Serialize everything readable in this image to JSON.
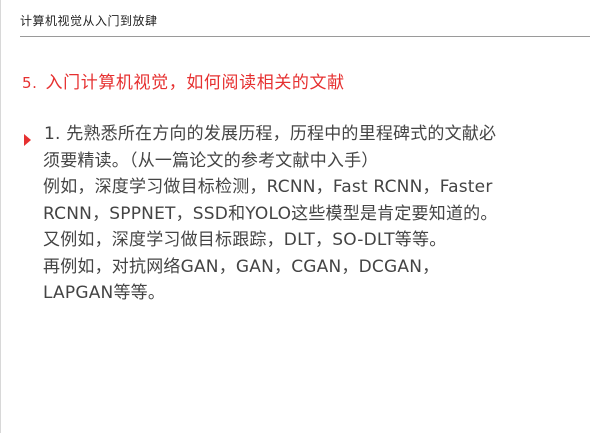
{
  "header": {
    "title": "计算机视觉从入门到放肆"
  },
  "section": {
    "number": "5.",
    "title": "入门计算机视觉，如何阅读相关的文献"
  },
  "body": {
    "lines": [
      "1. 先熟悉所在方向的发展历程，历程中的里程碑式的文献必",
      "须要精读。（从一篇论文的参考文献中入手）",
      "例如，深度学习做目标检测，RCNN，Fast RCNN，Faster",
      "RCNN，SPPNET，SSD和YOLO这些模型是肯定要知道的。",
      "又例如，深度学习做目标跟踪，DLT，SO-DLT等等。",
      "再例如，对抗网络GAN，GAN，CGAN，DCGAN，",
      "LAPGAN等等。"
    ]
  },
  "colors": {
    "accent": "#e63030",
    "body_text": "#444444",
    "header_text": "#222222",
    "rule": "#9a9a9a"
  },
  "icons": {
    "bullet": "triangle-right-icon"
  }
}
